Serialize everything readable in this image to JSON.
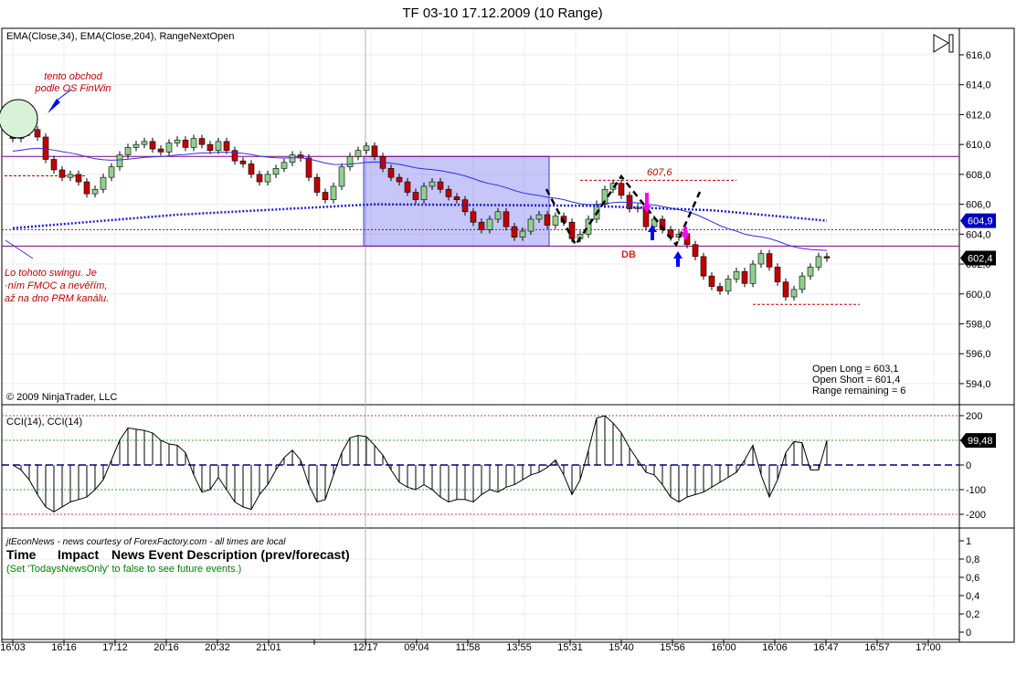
{
  "title": "TF 03-10  17.12.2009 (10 Range)",
  "indicator_label": "EMA(Close,34), EMA(Close,204), RangeNextOpen",
  "copyright": "© 2009 NinjaTrader, LLC",
  "annotations": {
    "note1": [
      "tento obchod",
      "podle OS FinWin"
    ],
    "note2": [
      "Lo tohoto swingu. Je",
      "·ním FMOC a nevěřím,",
      "až na dno PRM kanálu."
    ],
    "level_label": "607,6",
    "db_label": "DB"
  },
  "info_box": [
    "Open Long = 603,1",
    "Open Short = 601,4",
    "Range remaining = 6"
  ],
  "cci_label": "CCI(14), CCI(14)",
  "news": {
    "header": "jtEconNews - news courtesy of ForexFactory.com - all times are local",
    "col_time": "Time",
    "col_impact": "Impact",
    "col_desc": "News Event Description (prev/forecast)",
    "note": "(Set 'TodaysNewsOnly' to false to see future events.)"
  },
  "colors": {
    "up": "#90d090",
    "down": "#c00000",
    "ema_fast": "#3030e0",
    "ema_slow": "#2020d0",
    "box": "#8080f0",
    "level": "#800080"
  },
  "chart_data": [
    {
      "type": "candlestick",
      "title": "TF 03-10  17.12.2009 (10 Range)",
      "ylim": [
        593,
        617
      ],
      "y_ticks": [
        "616,0",
        "614,0",
        "612,0",
        "610,0",
        "608,0",
        "606,0",
        "604,0",
        "602,0",
        "600,0",
        "598,0",
        "596,0",
        "594,0"
      ],
      "y_tick_values": [
        616,
        614,
        612,
        610,
        608,
        606,
        604,
        602,
        600,
        598,
        596,
        594
      ],
      "x_tick_labels": [
        "16:03",
        "16:16",
        "17:12",
        "20:16",
        "20:32",
        "21:01",
        "",
        "12/17",
        "09:04",
        "11:58",
        "13:55",
        "15:31",
        "15:40",
        "15:56",
        "16:00",
        "16:06",
        "16:47",
        "16:57",
        "17:00"
      ],
      "closes": [
        610.4,
        610.8,
        611.0,
        610.5,
        609.0,
        608.3,
        607.8,
        608.0,
        607.5,
        606.7,
        607.0,
        607.8,
        608.5,
        609.3,
        609.8,
        610.0,
        610.2,
        609.7,
        609.5,
        610.1,
        610.3,
        609.8,
        610.4,
        610.0,
        609.6,
        610.2,
        609.6,
        608.9,
        608.7,
        608.0,
        607.5,
        608.0,
        608.4,
        608.8,
        609.3,
        609.1,
        607.8,
        606.8,
        606.3,
        607.2,
        608.5,
        609.2,
        609.6,
        609.9,
        609.2,
        608.4,
        607.8,
        607.5,
        606.8,
        606.3,
        607.2,
        607.5,
        607.0,
        606.5,
        606.3,
        605.5,
        604.8,
        604.3,
        605.0,
        605.5,
        604.5,
        603.8,
        604.2,
        605.0,
        605.3,
        604.6,
        605.2,
        604.8,
        603.7,
        604.0,
        605.0,
        606.0,
        607.0,
        607.4,
        606.6,
        605.7,
        605.8,
        604.5,
        605.0,
        604.3,
        603.8,
        604.0,
        603.3,
        602.5,
        601.2,
        600.5,
        600.2,
        601.0,
        601.5,
        600.7,
        602.0,
        602.7,
        601.8,
        600.8,
        599.8,
        600.3,
        601.2,
        601.8,
        602.5,
        602.4
      ],
      "ema_slow_anchors": [
        [
          0,
          604.4
        ],
        [
          20,
          605.3
        ],
        [
          44,
          606.0
        ],
        [
          70,
          605.9
        ],
        [
          85,
          605.6
        ],
        [
          99,
          604.9
        ]
      ],
      "ema_fast_last": "602,4",
      "ema_slow_last": "604,9",
      "levels": [
        609.2,
        603.2
      ],
      "dashed_level": 604.3,
      "segment_levels": [
        {
          "value": 607.6,
          "from": 69,
          "to": 88
        },
        {
          "value": 599.3,
          "from": 90,
          "to": 103
        },
        {
          "value": 607.9,
          "from": -1,
          "to": 9
        }
      ],
      "box": {
        "from": 43,
        "to": 65,
        "top": 609.2,
        "bottom": 603.2
      }
    },
    {
      "type": "line",
      "title": "CCI(14), CCI(14)",
      "ylim": [
        -260,
        230
      ],
      "y_ticks": [
        "200",
        "100",
        "0",
        "-100",
        "-200"
      ],
      "y_tick_values": [
        200,
        100,
        0,
        -100,
        -200
      ],
      "last_value": "99,48",
      "values": [
        0,
        -20,
        -60,
        -120,
        -170,
        -190,
        -170,
        -150,
        -140,
        -130,
        -100,
        -60,
        20,
        100,
        150,
        145,
        140,
        130,
        100,
        85,
        80,
        50,
        -40,
        -110,
        -100,
        -50,
        -100,
        -150,
        -170,
        -180,
        -120,
        -80,
        -20,
        30,
        60,
        20,
        -80,
        -150,
        -140,
        -40,
        50,
        110,
        120,
        115,
        80,
        40,
        -20,
        -70,
        -90,
        -100,
        -80,
        -100,
        -130,
        -150,
        -140,
        -140,
        -150,
        -120,
        -100,
        -110,
        -90,
        -80,
        -60,
        -40,
        -30,
        -10,
        20,
        -40,
        -120,
        -60,
        60,
        190,
        200,
        170,
        130,
        70,
        20,
        -30,
        -40,
        -80,
        -130,
        -150,
        -130,
        -120,
        -110,
        -90,
        -70,
        -50,
        -30,
        20,
        80,
        -40,
        -130,
        -60,
        50,
        95,
        90,
        -20,
        -20,
        99.48
      ]
    },
    {
      "type": "table",
      "title": "jtEconNews",
      "ylim": [
        0,
        1
      ],
      "y_ticks": [
        "1",
        "0,8",
        "0,6",
        "0,4",
        "0,2",
        "0"
      ]
    }
  ]
}
